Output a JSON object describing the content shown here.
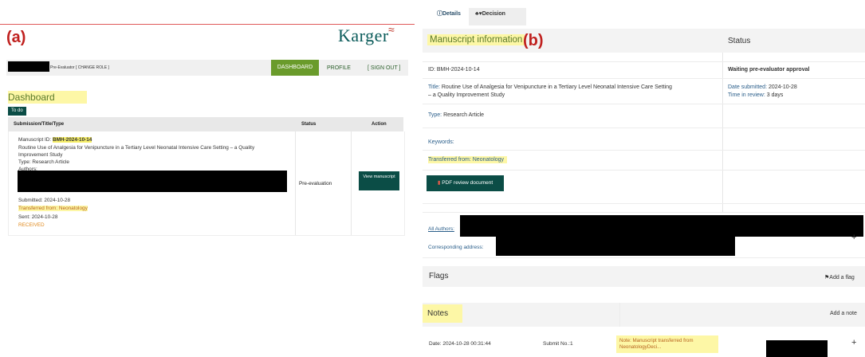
{
  "left": {
    "panel_label": "(a)",
    "logo": "Karger",
    "role_text": "Pre-Evaluator [ CHANGE ROLE ]",
    "nav": {
      "dashboard": "DASHBOARD",
      "profile": "PROFILE",
      "signout": "[ SIGN OUT ]"
    },
    "dashboard_title": "Dashboard",
    "todo_tab": "To do",
    "columns": {
      "submission": "Submission/Title/Type",
      "status": "Status",
      "action": "Action"
    },
    "row": {
      "manuscript_id_label": "Manuscript ID:",
      "manuscript_id": "BMH-2024-10-14",
      "title_line1": "Routine Use of Analgesia for Venipuncture in a Tertiary Level Neonatal Intensive Care Setting – a Quality",
      "title_line2": "Improvement Study",
      "type": "Type: Research Article",
      "authors": "Authors:",
      "submitted": "Submitted: 2024-10-28",
      "transferred": "Transferred from: Neonatology",
      "sent": "Sent: 2024-10-28",
      "received": "RECEIVED",
      "status": "Pre-evaluation",
      "action_btn": "View manuscript"
    }
  },
  "right": {
    "panel_label": "(b)",
    "tabs": {
      "details": "Details",
      "decision": "Decision"
    },
    "manuscript_info_title": "Manuscript information",
    "status_title": "Status",
    "id": "ID: BMH-2024-10-14",
    "status_value": "Waiting pre-evaluator approval",
    "title_label": "Title:",
    "title_value_line1": "Routine Use of Analgesia for Venipuncture in a Tertiary Level Neonatal Intensive Care Setting",
    "title_value_line2": "– a Quality Improvement Study",
    "date_submitted_label": "Date submitted:",
    "date_submitted": "2024-10-28",
    "time_in_review_label": "Time in review:",
    "time_in_review": "3 days",
    "type_label": "Type:",
    "type_value": "Research Article",
    "keywords_label": "Keywords:",
    "transferred": "Transferred from: Neonatology",
    "pdf_btn": "PDF review document",
    "all_authors": "All Authors:",
    "corresponding": "Corresponding address:",
    "flags_title": "Flags",
    "add_flag": "Add a flag",
    "notes_title": "Notes",
    "add_note": "Add a note",
    "note_date": "Date: 2024-10-28 00:31:44",
    "note_submit": "Submit No.:1",
    "note_text_line1": "Note: Manuscript transferred from",
    "note_text_line2": "NeonatologyDeci..."
  }
}
